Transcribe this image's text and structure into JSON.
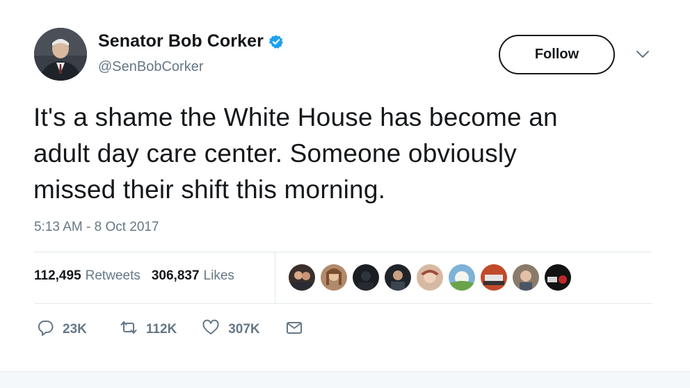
{
  "author": {
    "display_name": "Senator Bob Corker",
    "handle": "@SenBobCorker",
    "verified": true
  },
  "follow_label": "Follow",
  "tweet": {
    "text_lines": [
      "It's a shame the White House has become an",
      "adult day care center. Someone obviously",
      "missed their shift this morning."
    ],
    "timestamp": "5:13 AM - 8 Oct 2017"
  },
  "stats": {
    "retweets_count": "112,495",
    "retweets_label": "Retweets",
    "likes_count": "306,837",
    "likes_label": "Likes"
  },
  "actions": {
    "reply_count": "23K",
    "retweet_count": "112K",
    "like_count": "307K"
  },
  "colors": {
    "text_primary": "#14171a",
    "text_secondary": "#657786",
    "verified_blue": "#1da1f2",
    "divider": "#e1e8ed"
  },
  "icons": [
    "verified-badge-icon",
    "chevron-down-icon",
    "reply-icon",
    "retweet-icon",
    "like-heart-icon",
    "direct-message-icon"
  ],
  "liker_avatar_count": 9
}
